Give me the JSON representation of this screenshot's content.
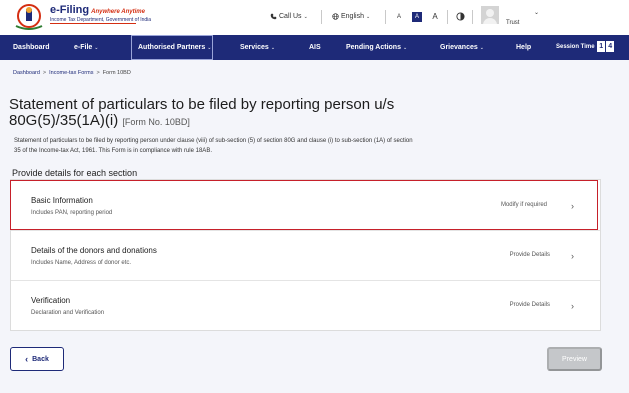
{
  "header": {
    "brand_title": "e-Filing",
    "brand_tagline": "Anywhere Anytime",
    "brand_subtitle": "Income Tax Department, Government of India",
    "call_us": "Call Us",
    "language": "English",
    "font_small": "A",
    "font_normal": "A",
    "font_large": "A",
    "user_name": "Trust",
    "icons": [
      "emblem-logo-icon",
      "phone-icon",
      "globe-icon",
      "contrast-icon",
      "avatar",
      "chevron-down-icon"
    ]
  },
  "nav": {
    "items": [
      {
        "label": "Dashboard"
      },
      {
        "label": "e-File"
      },
      {
        "label": "Authorised Partners"
      },
      {
        "label": "Services"
      },
      {
        "label": "AIS"
      },
      {
        "label": "Pending Actions"
      },
      {
        "label": "Grievances"
      },
      {
        "label": "Help"
      }
    ],
    "session_label": "Session Time",
    "session_digits": [
      "1",
      "4"
    ]
  },
  "breadcrumb": {
    "items": [
      "Dashboard",
      "Income-tax Forms",
      "Form 10BD"
    ],
    "separator": ">"
  },
  "page": {
    "title": "Statement of particulars to be filed by reporting person u/s 80G(5)/35(1A)(i)",
    "form_number": "[Form No. 10BD]",
    "description": "Statement of particulars to be filed by reporting person under clause (viii) of sub-section (5) of section 80G and clause (i) to sub-section (1A) of section 35 of the Income-tax Act, 1961. This Form is in compliance with rule 18AB.",
    "section_heading": "Provide details for each section"
  },
  "sections": [
    {
      "title": "Basic Information",
      "subtitle": "Includes PAN, reporting period",
      "action": "Modify if required",
      "selected": true
    },
    {
      "title": "Details of the donors and donations",
      "subtitle": "Includes Name, Address of donor etc.",
      "action": "Provide Details",
      "selected": false
    },
    {
      "title": "Verification",
      "subtitle": "Declaration and Verification",
      "action": "Provide Details",
      "selected": false
    }
  ],
  "footer": {
    "back_label": "Back",
    "preview_label": "Preview",
    "preview_disabled": true
  },
  "colors": {
    "nav_bg": "#1e2a78",
    "accent_red": "#c6202a",
    "brand_red": "#d42e12",
    "disabled_btn": "#c5c7ca",
    "page_bg": "#f4f5fa"
  }
}
